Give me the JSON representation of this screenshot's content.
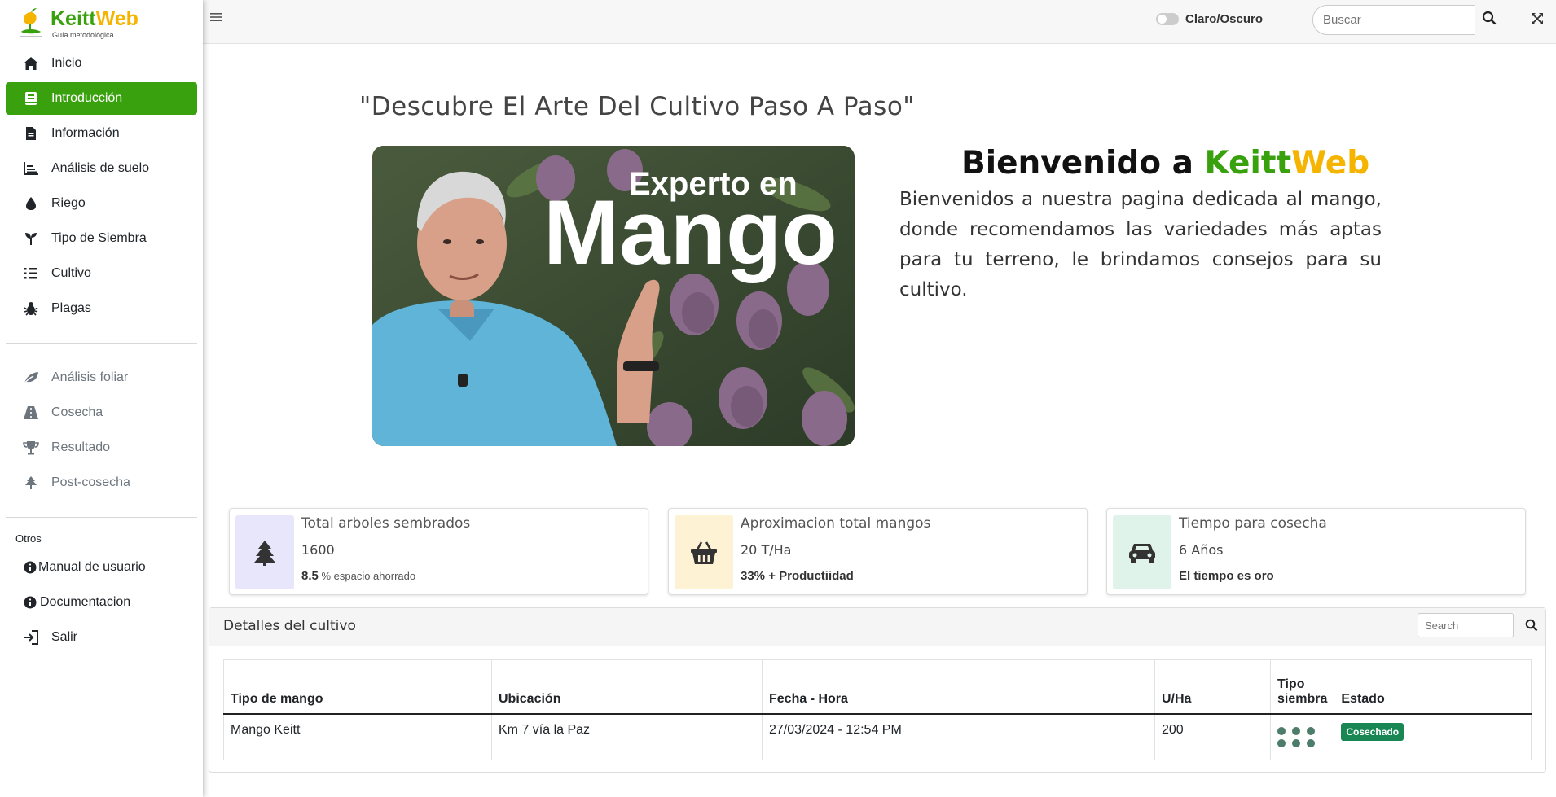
{
  "app": {
    "brand_left": "Keitt",
    "brand_right": "Web",
    "brand_sub": "Guía metodológica"
  },
  "sidebar": {
    "main_items": [
      {
        "label": "Inicio",
        "icon": "home-icon"
      },
      {
        "label": "Introducción",
        "icon": "book-icon",
        "active": true
      },
      {
        "label": "Información",
        "icon": "file-icon"
      },
      {
        "label": "Análisis de suelo",
        "icon": "chart-icon"
      },
      {
        "label": "Riego",
        "icon": "droplet-icon"
      },
      {
        "label": "Tipo de Siembra",
        "icon": "seedling-icon"
      },
      {
        "label": "Cultivo",
        "icon": "list-icon"
      },
      {
        "label": "Plagas",
        "icon": "bug-icon"
      }
    ],
    "secondary_items": [
      {
        "label": "Análisis foliar",
        "icon": "leaf-icon"
      },
      {
        "label": "Cosecha",
        "icon": "road-icon"
      },
      {
        "label": "Resultado",
        "icon": "trophy-icon"
      },
      {
        "label": "Post-cosecha",
        "icon": "tree-icon"
      }
    ],
    "others_label": "Otros",
    "other_items": [
      {
        "label": "Manual de usuario",
        "icon": "info-icon"
      },
      {
        "label": "Documentacion",
        "icon": "info-icon"
      },
      {
        "label": "Salir",
        "icon": "sign-in-icon"
      }
    ]
  },
  "topbar": {
    "theme_toggle_label": "Claro/Oscuro",
    "search_placeholder": "Buscar"
  },
  "hero": {
    "title": "\"Descubre El Arte Del Cultivo Paso A Paso\"",
    "image_text_small": "Experto en",
    "image_text_big": "Mango",
    "welcome_prefix": "Bienvenido a ",
    "welcome_brand_left": "Keitt",
    "welcome_brand_right": "Web",
    "welcome_text": "Bienvenidos a nuestra pagina dedicada al mango, donde recomendamos las variedades más aptas para tu terreno, le brindamos consejos para su cultivo."
  },
  "stats": [
    {
      "title": "Total arboles sembrados",
      "value": "1600",
      "footer_strong": "8.5",
      "footer_small": " % espacio ahorrado",
      "icon": "tree-icon",
      "bg": "#e7e6fb"
    },
    {
      "title": "Aproximacion total mangos",
      "value": "20 T/Ha",
      "footer_strong": "33% + Productiidad",
      "footer_small": "",
      "icon": "basket-icon",
      "bg": "#fdf3d4"
    },
    {
      "title": "Tiempo para cosecha",
      "value": "6 Años",
      "footer_strong": "El tiempo es oro",
      "footer_small": "",
      "icon": "car-icon",
      "bg": "#dff3ea"
    }
  ],
  "table": {
    "title": "Detalles del cultivo",
    "search_placeholder": "Search",
    "headers": [
      "Tipo de mango",
      "Ubicación",
      "Fecha - Hora",
      "U/Ha",
      "Tipo siembra",
      "Estado"
    ],
    "rows": [
      {
        "tipo": "Mango Keitt",
        "ubicacion": "Km 7 vía la Paz",
        "fecha": "27/03/2024 - 12:54 PM",
        "uha": "200",
        "siembra_icon": "grid-dots-icon",
        "estado": "Cosechado"
      }
    ]
  },
  "colors": {
    "brand_green": "#3aa10e",
    "brand_orange": "#f5b400",
    "badge_green": "#198754"
  }
}
